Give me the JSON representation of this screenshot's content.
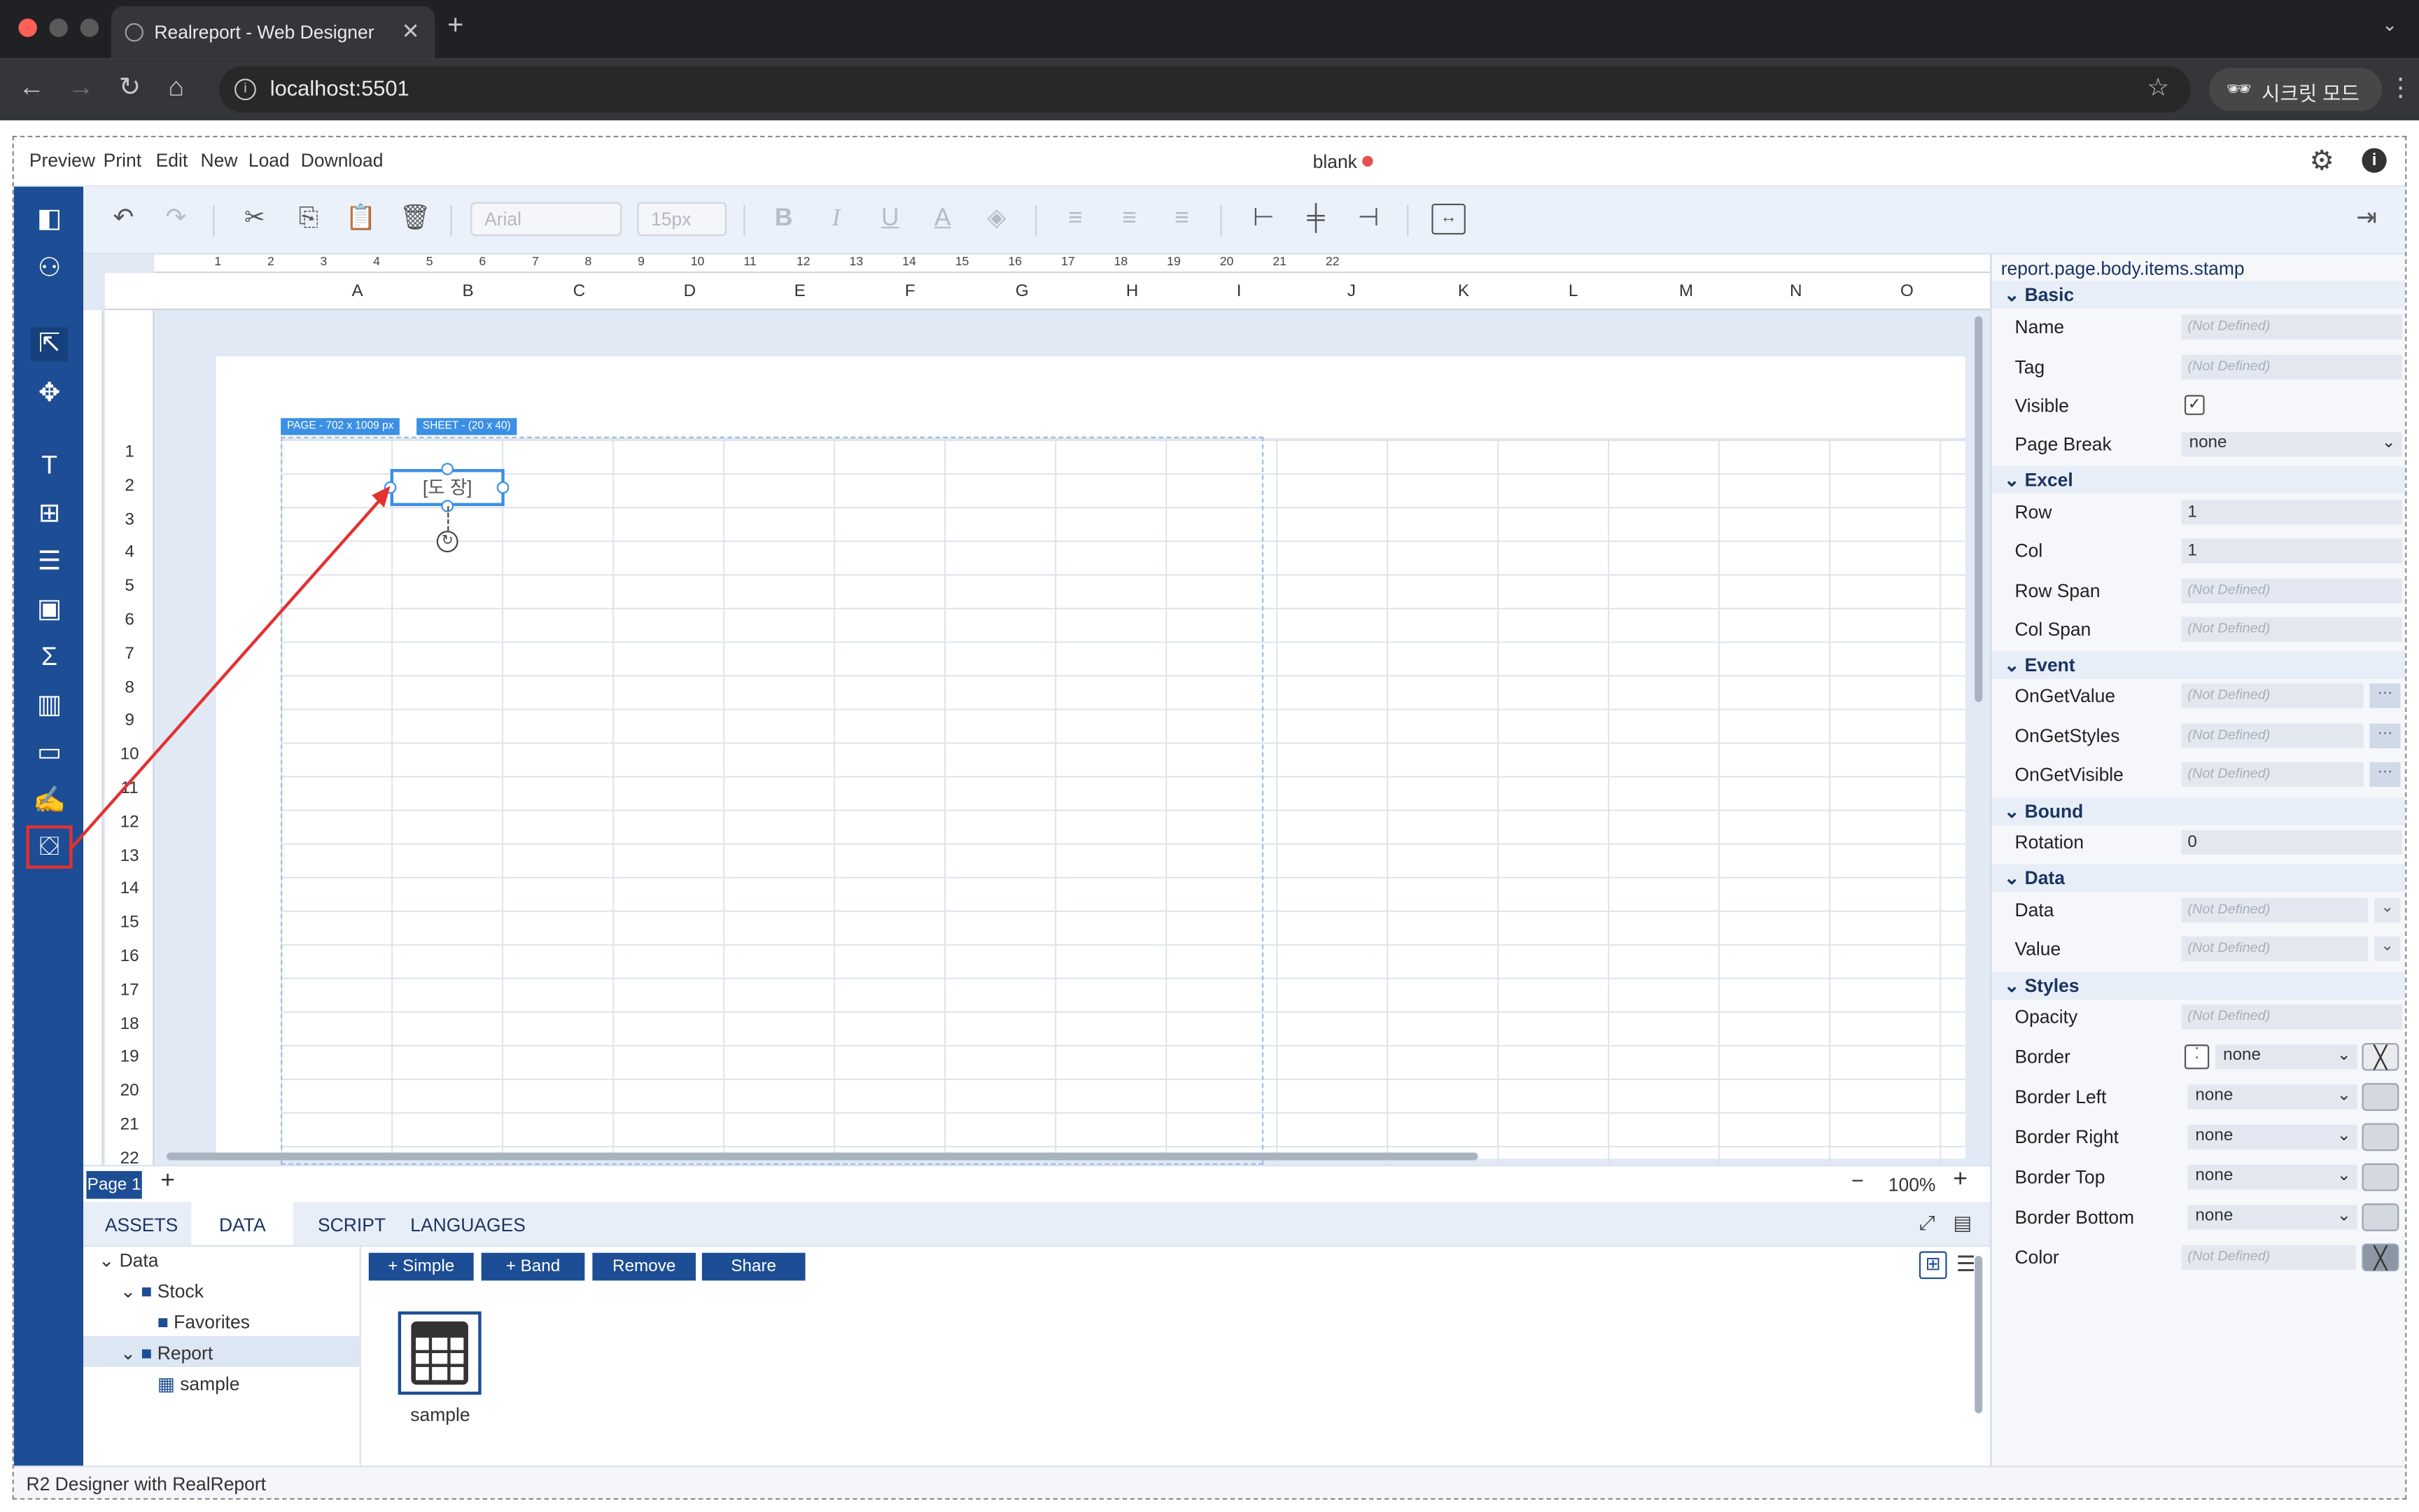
{
  "browser": {
    "tab_title": "Realreport - Web Designer",
    "address": "localhost:5501",
    "incognito_label": "시크릿 모드"
  },
  "menu": {
    "items": [
      "Preview",
      "Print",
      "Edit",
      "New",
      "Load",
      "Download"
    ],
    "doc_title": "blank"
  },
  "toolbar": {
    "font_family": "Arial",
    "font_size": "15px"
  },
  "ruler": [
    "1",
    "2",
    "3",
    "4",
    "5",
    "6",
    "7",
    "8",
    "9",
    "10",
    "11",
    "12",
    "13",
    "14",
    "15",
    "16",
    "17",
    "18",
    "19",
    "20",
    "21",
    "22"
  ],
  "columns": [
    "A",
    "B",
    "C",
    "D",
    "E",
    "F",
    "G",
    "H",
    "I",
    "J",
    "K",
    "L",
    "M",
    "N",
    "O"
  ],
  "rows": [
    "1",
    "2",
    "3",
    "4",
    "5",
    "6",
    "7",
    "8",
    "9",
    "10",
    "11",
    "12",
    "13",
    "14",
    "15",
    "16",
    "17",
    "18",
    "19",
    "20",
    "21",
    "22"
  ],
  "canvas": {
    "page_badge": "PAGE - 702 x 1009 px",
    "sheet_badge": "SHEET - (20 x 40)",
    "stamp_text": "[도 장]"
  },
  "pages": {
    "current": "Page 1",
    "zoom": "100%"
  },
  "bottom": {
    "tabs": [
      "ASSETS",
      "DATA",
      "SCRIPT",
      "LANGUAGES"
    ],
    "active_tab": "DATA",
    "tree": [
      "Data",
      "Stock",
      "Favorites",
      "Report",
      "sample"
    ],
    "buttons": [
      "+ Simple",
      "+ Band",
      "Remove",
      "Share"
    ],
    "item_label": "sample"
  },
  "status": "R2 Designer with RealReport",
  "props": {
    "path": "report.page.body.items.stamp",
    "placeholder": "(Not Defined)",
    "sections": [
      "Basic",
      "Excel",
      "Event",
      "Bound",
      "Data",
      "Styles"
    ],
    "basic": {
      "name": "Name",
      "tag": "Tag",
      "visible": "Visible",
      "page_break": "Page Break",
      "page_break_value": "none"
    },
    "excel": {
      "row": "Row",
      "row_value": "1",
      "col": "Col",
      "col_value": "1",
      "row_span": "Row Span",
      "col_span": "Col Span"
    },
    "event": {
      "on_get_value": "OnGetValue",
      "on_get_styles": "OnGetStyles",
      "on_get_visible": "OnGetVisible"
    },
    "bound": {
      "rotation": "Rotation",
      "rotation_value": "0"
    },
    "data": {
      "data": "Data",
      "value": "Value"
    },
    "styles": {
      "opacity": "Opacity",
      "border": "Border",
      "border_left": "Border Left",
      "border_right": "Border Right",
      "border_top": "Border Top",
      "border_bottom": "Border Bottom",
      "color": "Color",
      "none": "none"
    }
  },
  "colors": {
    "brand": "#1d4d94",
    "selection": "#3b8fe4",
    "annotation": "#e33131",
    "unsaved_dot": "#e65050"
  }
}
